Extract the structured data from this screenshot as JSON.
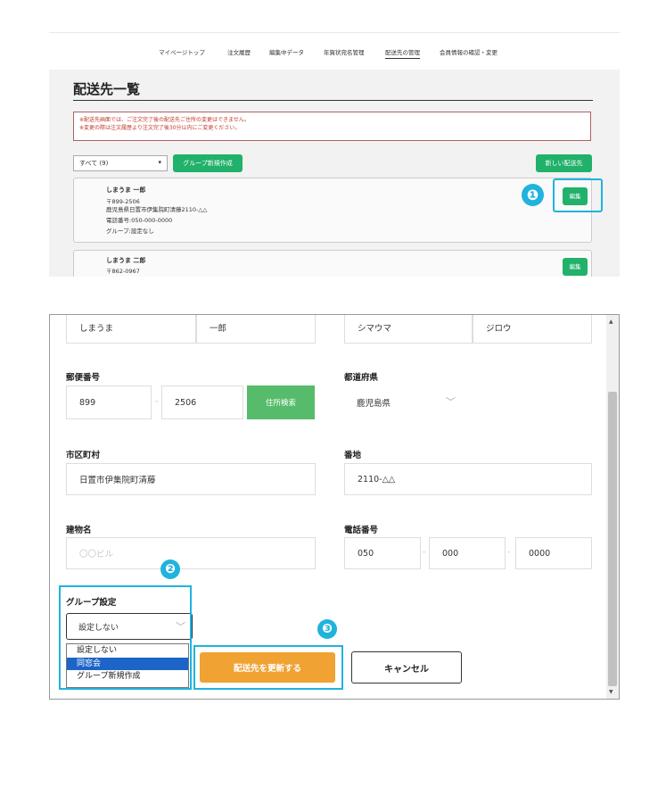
{
  "nav": {
    "items": [
      "マイページトップ",
      "注文履歴",
      "編集中データ",
      "年賀状宛名管理",
      "配送先の管理",
      "会員情報の確認・変更"
    ],
    "active": "配送先の管理"
  },
  "list": {
    "title": "配送先一覧",
    "notice": [
      "※配送先画面では、ご注文完了後の配送先ご住所の変更はできません。",
      "※変更の際は注文履歴より注文完了後30分以内にご変更ください。"
    ],
    "group_filter": "すべて (9)",
    "new_group_button": "グループ新規作成",
    "new_address_button": "新しい配送先",
    "cards": [
      {
        "name": "しまうま 一郎",
        "zip": "〒899-2506",
        "address": "鹿児島県日置市伊集院町清藤2110-△△",
        "phone": "電話番号:050-000-0000",
        "group": "グループ:設定なし",
        "edit_label": "編集"
      },
      {
        "name": "しまうま 二郎",
        "zip": "〒862-0967",
        "edit_label": "編集"
      }
    ]
  },
  "badges": [
    "❶",
    "❷",
    "❸"
  ],
  "form": {
    "last_name": "しまうま",
    "first_name": "一郎",
    "last_name_kana": "シマウマ",
    "first_name_kana": "ジロウ",
    "postal_label": "郵便番号",
    "postal_1": "899",
    "postal_2": "2506",
    "postal_dash": "-",
    "address_search_button": "住所検索",
    "prefecture_label": "都道府県",
    "prefecture": "鹿児島県",
    "city_label": "市区町村",
    "city": "日置市伊集院町清藤",
    "street_label": "番地",
    "street": "2110-△△",
    "building_label": "建物名",
    "building_placeholder": "〇〇ビル",
    "phone_label": "電話番号",
    "phone_1": "050",
    "phone_2": "000",
    "phone_3": "0000",
    "phone_dash": "-",
    "group_label": "グループ設定",
    "group_selected": "設定しない",
    "group_options": [
      "設定しない",
      "同窓会",
      "グループ新規作成"
    ],
    "group_highlighted": "同窓会",
    "update_button": "配送先を更新する",
    "cancel_button": "キャンセル"
  },
  "colors": {
    "accent_green": "#21b16a",
    "highlight_blue": "#1fb3dd",
    "update_orange": "#f0a233",
    "notice_red": "#c0392b"
  }
}
